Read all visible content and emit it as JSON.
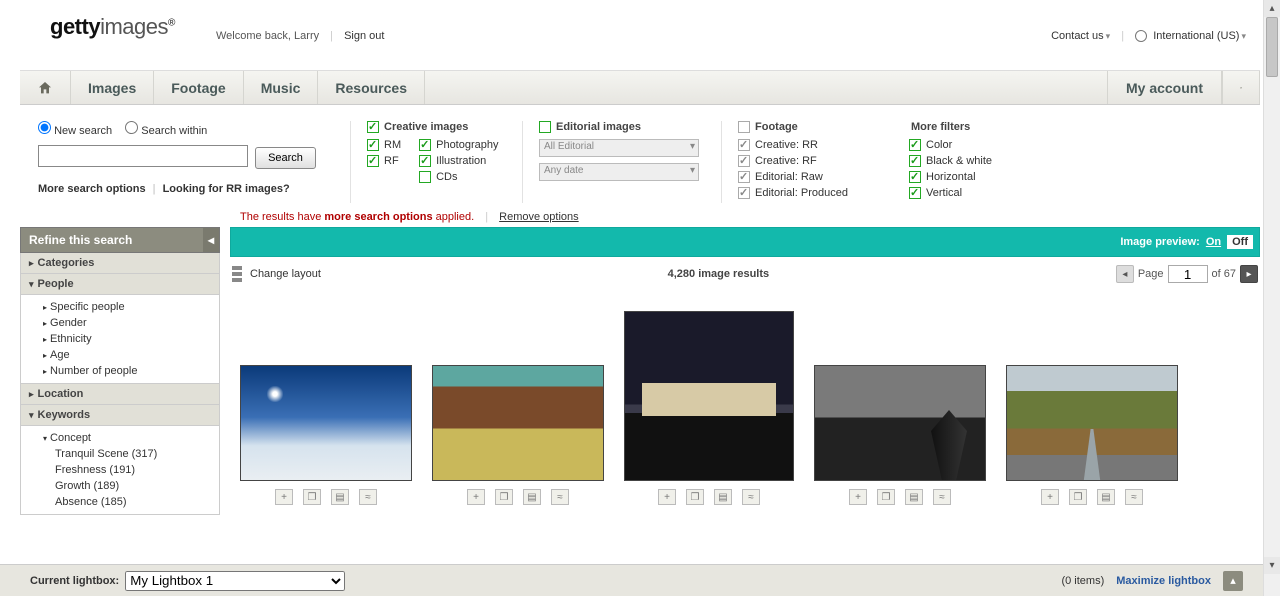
{
  "header": {
    "logo_bold": "getty",
    "logo_thin": "images",
    "logo_reg": "®",
    "welcome": "Welcome back, Larry",
    "signout": "Sign out",
    "contact": "Contact us",
    "intl": "International (US)"
  },
  "nav": {
    "images": "Images",
    "footage": "Footage",
    "music": "Music",
    "resources": "Resources",
    "account": "My account"
  },
  "search": {
    "new": "New search",
    "within": "Search within",
    "button": "Search",
    "more_opts": "More search options",
    "rr": "Looking for RR images?"
  },
  "filters": {
    "creative": {
      "hd": "Creative images",
      "rm": "RM",
      "rf": "RF",
      "photo": "Photography",
      "illus": "Illustration",
      "cds": "CDs"
    },
    "editorial": {
      "hd": "Editorial images",
      "sel1": "All Editorial",
      "sel2": "Any date"
    },
    "footage": {
      "hd": "Footage",
      "crr": "Creative: RR",
      "crf": "Creative: RF",
      "raw": "Editorial: Raw",
      "prod": "Editorial: Produced"
    },
    "more": {
      "hd": "More filters",
      "color": "Color",
      "bw": "Black & white",
      "horiz": "Horizontal",
      "vert": "Vertical"
    }
  },
  "moreline": {
    "p1": "The results have ",
    "p2": "more search options",
    "p3": " applied.",
    "remove": "Remove options"
  },
  "sidebar": {
    "refine": "Refine this search",
    "categories": "Categories",
    "people": "People",
    "people_items": [
      "Specific people",
      "Gender",
      "Ethnicity",
      "Age",
      "Number of people"
    ],
    "location": "Location",
    "keywords": "Keywords",
    "concept": "Concept",
    "concept_items": [
      "Tranquil Scene (317)",
      "Freshness (191)",
      "Growth (189)",
      "Absence (185)"
    ]
  },
  "teal": {
    "label": "Image preview:",
    "on": "On",
    "off": "Off"
  },
  "toolbar": {
    "change": "Change layout",
    "results": "4,280 image results",
    "page_lbl": "Page",
    "page_val": "1",
    "of": "of 67"
  },
  "lightbox": {
    "label": "Current lightbox:",
    "selected": "My Lightbox 1",
    "items": "(0 items)",
    "max": "Maximize lightbox"
  }
}
